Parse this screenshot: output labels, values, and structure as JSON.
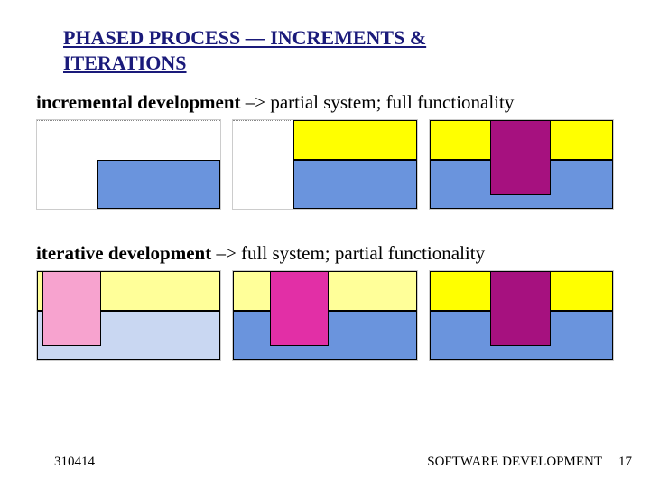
{
  "title": "PHASED PROCESS — INCREMENTS & ITERATIONS",
  "incremental": {
    "lead": "incremental development",
    "rest": " –> partial system; full functionality"
  },
  "iterative": {
    "lead": "iterative development",
    "rest": " –> full system; partial functionality"
  },
  "footer": {
    "left": "310414",
    "mid": "SOFTWARE DEVELOPMENT",
    "page": "17"
  },
  "colors": {
    "blue": "#6a94dd",
    "blue_light": "#c9d7f2",
    "yellow": "#ffff00",
    "yellow_light": "#ffff99",
    "magenta_dark": "#a6117f",
    "magenta_bright": "#e22fa6",
    "pink": "#f7a3cf"
  }
}
